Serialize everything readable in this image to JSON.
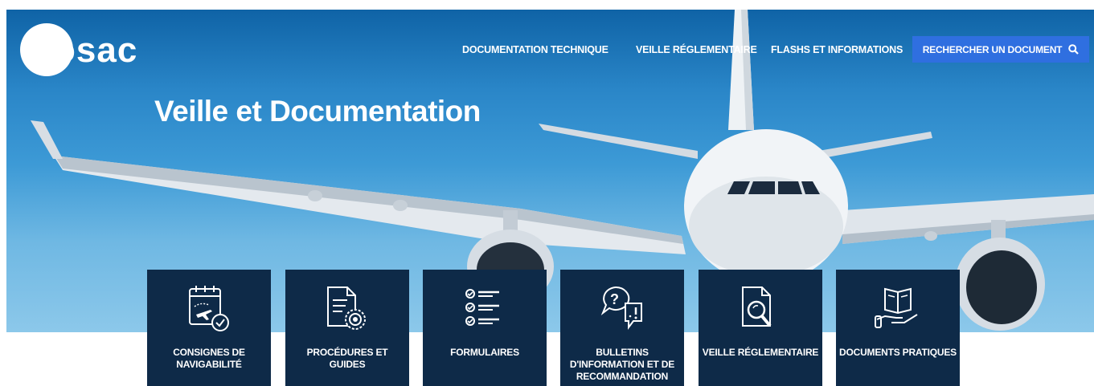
{
  "brand": {
    "logo_text": "osac"
  },
  "nav": {
    "items": [
      {
        "label": "DOCUMENTATION TECHNIQUE"
      },
      {
        "label": "VEILLE RÉGLEMENTAIRE"
      },
      {
        "label": "FLASHS ET INFORMATIONS"
      }
    ],
    "search_label": "RECHERCHER UN DOCUMENT",
    "search_icon": "magnifier-icon"
  },
  "hero": {
    "title": "Veille et Documentation"
  },
  "cards": [
    {
      "label": "CONSIGNES DE NAVIGABILITÉ",
      "icon": "calendar-plane-check-icon"
    },
    {
      "label": "PROCÉDURES ET GUIDES",
      "icon": "document-gear-icon"
    },
    {
      "label": "FORMULAIRES",
      "icon": "checklist-icon"
    },
    {
      "label": "BULLETINS D'INFORMATION ET DE RECOMMANDATION",
      "icon": "speech-bubbles-icon"
    },
    {
      "label": "VEILLE RÉGLEMENTAIRE",
      "icon": "document-magnifier-icon"
    },
    {
      "label": "DOCUMENTS PRATIQUES",
      "icon": "book-hand-icon"
    }
  ],
  "colors": {
    "card_bg": "#0e2a48",
    "search_bg": "#2f6fe0",
    "sky_top": "#0f63a6",
    "sky_bottom": "#8cc8ea"
  }
}
